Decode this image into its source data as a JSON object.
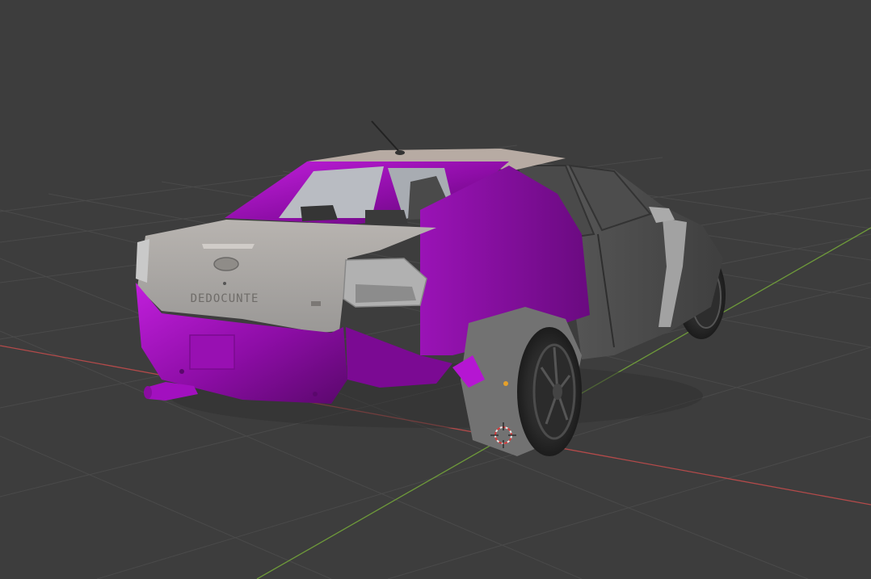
{
  "viewport": {
    "background_color": "#3d3d3d",
    "grid_color": "#4a4a4a",
    "x_axis_color": "#b34a4a",
    "y_axis_color": "#6e9a3a",
    "selected_material_color": "#a10fc0",
    "body_color": "#9a9a9a"
  },
  "model": {
    "badge_text": "DEDOCUNTE",
    "plate_area": "",
    "icon": "car-model-icon"
  },
  "overlay": {
    "cursor_icon": "3d-cursor-icon",
    "origin_icon": "object-origin-icon"
  }
}
